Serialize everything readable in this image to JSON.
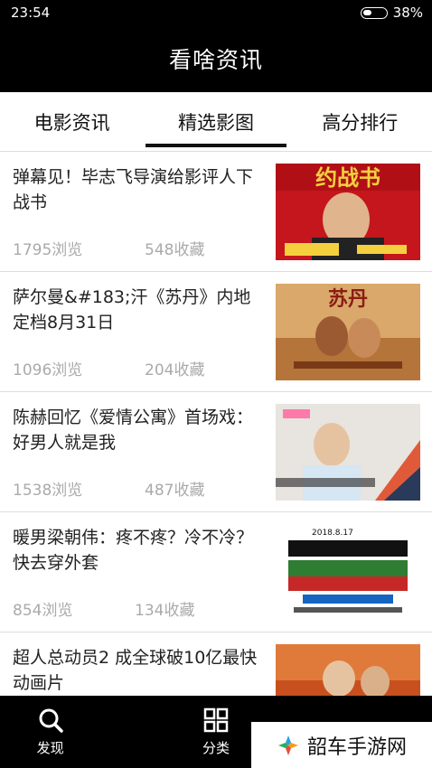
{
  "status": {
    "time": "23:54",
    "battery_percent": "38%",
    "battery_level": 0.38
  },
  "header": {
    "title": "看啥资讯"
  },
  "tabs": [
    {
      "label": "电影资讯",
      "active": false
    },
    {
      "label": "精选影图",
      "active": true
    },
    {
      "label": "高分排行",
      "active": false
    }
  ],
  "articles": [
    {
      "title": "弹幕见！毕志飞导演给影评人下战书",
      "views": "1795浏览",
      "favorites": "548收藏",
      "poster_text": "约战书"
    },
    {
      "title": "萨尔曼&#183;汗《苏丹》内地定档8月31日",
      "views": "1096浏览",
      "favorites": "204收藏",
      "poster_text": "苏丹"
    },
    {
      "title": "陈赫回忆《爱情公寓》首场戏：好男人就是我",
      "views": "1538浏览",
      "favorites": "487收藏",
      "poster_text": ""
    },
    {
      "title": "暖男梁朝伟：疼不疼？冷不冷？快去穿外套",
      "views": "854浏览",
      "favorites": "134收藏",
      "poster_text": "2018.8.17"
    },
    {
      "title": "超人总动员2  成全球破10亿最快动画片",
      "views": "",
      "favorites": "",
      "poster_text": ""
    }
  ],
  "bottom_nav": [
    {
      "label": "发现",
      "icon": "search-icon"
    },
    {
      "label": "分类",
      "icon": "grid-icon"
    },
    {
      "label": "",
      "icon": "dot-icon"
    }
  ],
  "watermark": {
    "text": "韶车手游网"
  },
  "colors": {
    "bar": "#000000",
    "muted": "#aaaaaa",
    "divider": "#dddddd"
  }
}
